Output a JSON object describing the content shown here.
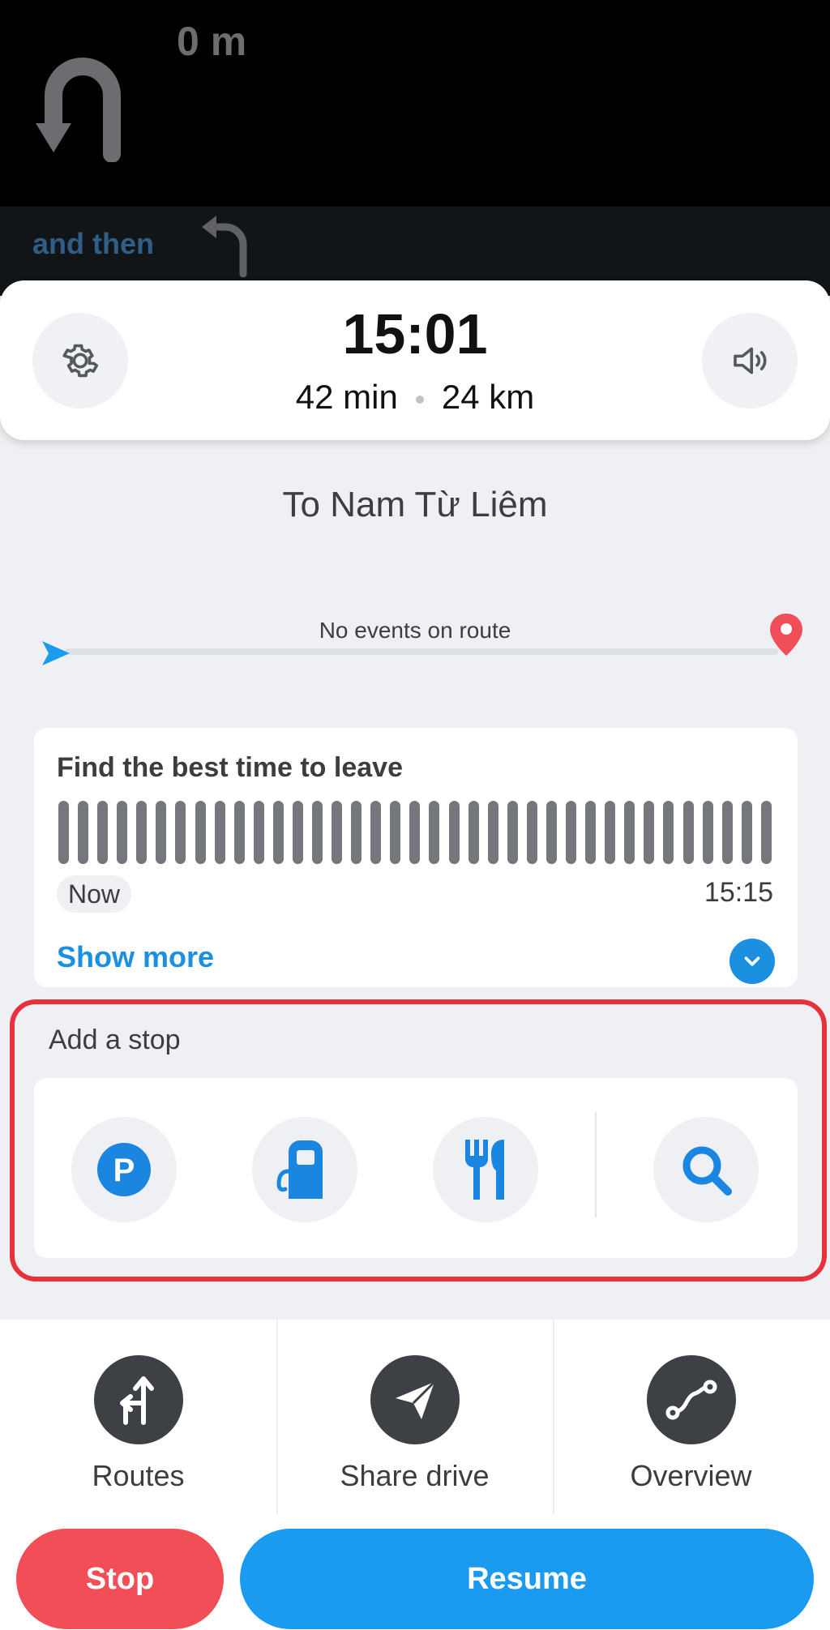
{
  "nav": {
    "distance": "0 m",
    "then_label": "and then"
  },
  "eta": {
    "arrival_time": "15:01",
    "duration": "42 min",
    "distance": "24 km"
  },
  "destination": "To Nam Từ Liêm",
  "route_events": "No events on route",
  "best_time": {
    "title": "Find the best time to leave",
    "start_label": "Now",
    "end_label": "15:15",
    "show_more": "Show more"
  },
  "add_stop": {
    "title": "Add a stop",
    "options": [
      "parking-icon",
      "gas-station-icon",
      "restaurant-icon",
      "search-icon"
    ]
  },
  "actions": {
    "routes": "Routes",
    "share_drive": "Share drive",
    "overview": "Overview"
  },
  "buttons": {
    "stop": "Stop",
    "resume": "Resume"
  },
  "colors": {
    "accent": "#1a9bf0",
    "stop": "#f24e58",
    "highlight": "#e8323b"
  }
}
